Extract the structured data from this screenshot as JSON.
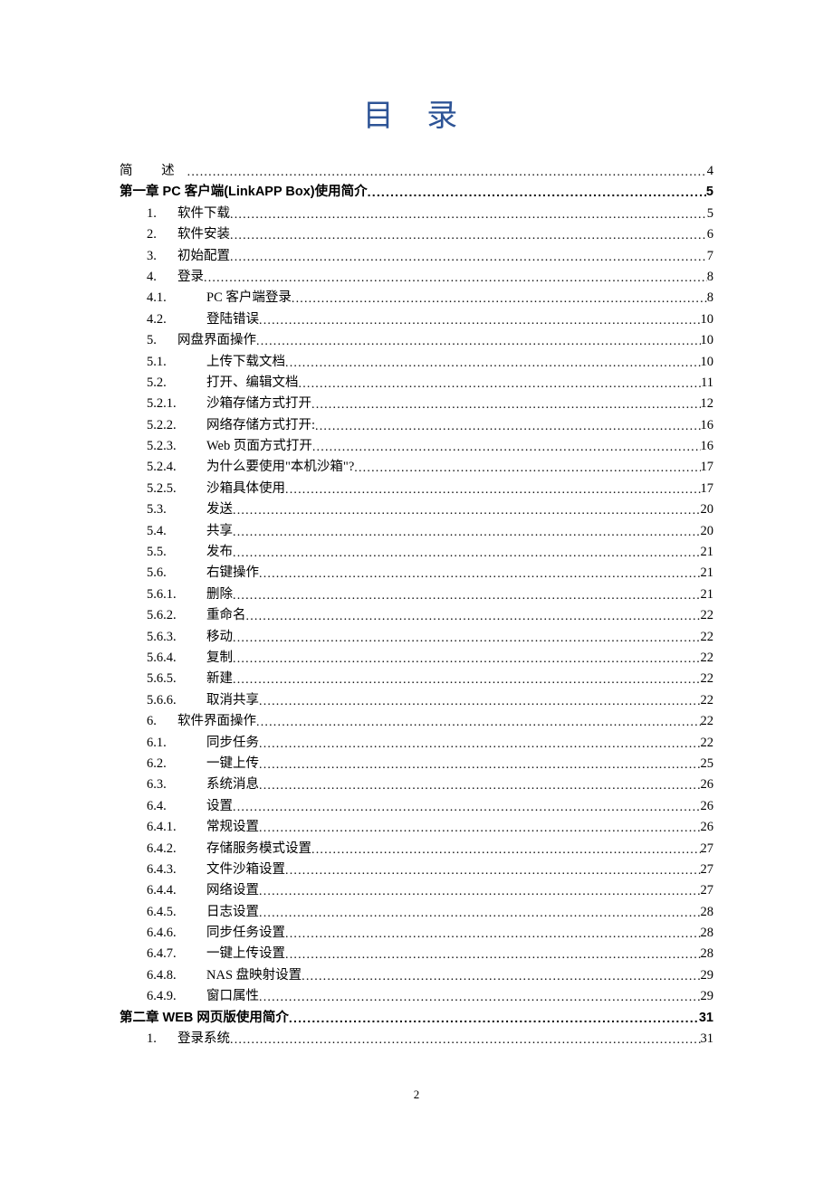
{
  "title": "目 录",
  "page_number": "2",
  "entries": [
    {
      "level": 0,
      "klass": "lvl0",
      "num": "",
      "text": "简  述",
      "page": "4",
      "spaced": true
    },
    {
      "level": 0,
      "klass": "lvl0 bold",
      "num": "",
      "text": "第一章 PC 客户端(LinkAPP Box)使用简介",
      "page": "5"
    },
    {
      "level": 1,
      "klass": "lvl1",
      "num": "1.",
      "text": "软件下载",
      "page": "5"
    },
    {
      "level": 1,
      "klass": "lvl1",
      "num": "2.",
      "text": "软件安装",
      "page": "6"
    },
    {
      "level": 1,
      "klass": "lvl1",
      "num": "3.",
      "text": "初始配置",
      "page": "7"
    },
    {
      "level": 1,
      "klass": "lvl1",
      "num": "4.",
      "text": "登录",
      "page": "8"
    },
    {
      "level": 2,
      "klass": "lvl2",
      "num": "4.1.",
      "text": "PC 客户端登录",
      "page": "8"
    },
    {
      "level": 2,
      "klass": "lvl2",
      "num": "4.2.",
      "text": "登陆错误",
      "page": "10"
    },
    {
      "level": 1,
      "klass": "lvl1",
      "num": "5.",
      "text": "网盘界面操作",
      "page": "10"
    },
    {
      "level": 2,
      "klass": "lvl2",
      "num": "5.1.",
      "text": "上传下载文档",
      "page": "10"
    },
    {
      "level": 2,
      "klass": "lvl2",
      "num": "5.2.",
      "text": "打开、编辑文档",
      "page": "11"
    },
    {
      "level": 3,
      "klass": "lvl3",
      "num": "5.2.1.",
      "text": "沙箱存储方式打开",
      "page": "12"
    },
    {
      "level": 3,
      "klass": "lvl3",
      "num": "5.2.2.",
      "text": "网络存储方式打开:",
      "page": "16"
    },
    {
      "level": 3,
      "klass": "lvl3",
      "num": "5.2.3.",
      "text": "Web 页面方式打开",
      "page": "16"
    },
    {
      "level": 3,
      "klass": "lvl3",
      "num": "5.2.4.",
      "text": "为什么要使用\"本机沙箱\"?",
      "page": "17"
    },
    {
      "level": 3,
      "klass": "lvl3",
      "num": "5.2.5.",
      "text": "沙箱具体使用",
      "page": "17"
    },
    {
      "level": 2,
      "klass": "lvl2",
      "num": "5.3.",
      "text": "发送",
      "page": "20"
    },
    {
      "level": 2,
      "klass": "lvl2",
      "num": "5.4.",
      "text": "共享",
      "page": "20"
    },
    {
      "level": 2,
      "klass": "lvl2",
      "num": "5.5.",
      "text": "发布",
      "page": "21"
    },
    {
      "level": 2,
      "klass": "lvl2",
      "num": "5.6.",
      "text": "右键操作",
      "page": "21"
    },
    {
      "level": 3,
      "klass": "lvl3",
      "num": "5.6.1.",
      "text": "删除",
      "page": "21"
    },
    {
      "level": 3,
      "klass": "lvl3",
      "num": "5.6.2.",
      "text": "重命名",
      "page": "22"
    },
    {
      "level": 3,
      "klass": "lvl3",
      "num": "5.6.3.",
      "text": "移动",
      "page": "22"
    },
    {
      "level": 3,
      "klass": "lvl3",
      "num": "5.6.4.",
      "text": "复制",
      "page": "22"
    },
    {
      "level": 3,
      "klass": "lvl3",
      "num": "5.6.5.",
      "text": "新建",
      "page": "22"
    },
    {
      "level": 3,
      "klass": "lvl3",
      "num": "5.6.6.",
      "text": "取消共享",
      "page": "22"
    },
    {
      "level": 1,
      "klass": "lvl1",
      "num": "6.",
      "text": "软件界面操作",
      "page": "22"
    },
    {
      "level": 2,
      "klass": "lvl2",
      "num": "6.1.",
      "text": "同步任务",
      "page": "22"
    },
    {
      "level": 2,
      "klass": "lvl2",
      "num": "6.2.",
      "text": "一键上传",
      "page": "25"
    },
    {
      "level": 2,
      "klass": "lvl2",
      "num": "6.3.",
      "text": "系统消息",
      "page": "26"
    },
    {
      "level": 2,
      "klass": "lvl2",
      "num": "6.4.",
      "text": "设置",
      "page": "26"
    },
    {
      "level": 3,
      "klass": "lvl3",
      "num": "6.4.1.",
      "text": "常规设置",
      "page": "26"
    },
    {
      "level": 3,
      "klass": "lvl3",
      "num": "6.4.2.",
      "text": "存储服务模式设置",
      "page": "27"
    },
    {
      "level": 3,
      "klass": "lvl3",
      "num": "6.4.3.",
      "text": "文件沙箱设置",
      "page": "27"
    },
    {
      "level": 3,
      "klass": "lvl3",
      "num": "6.4.4.",
      "text": "网络设置",
      "page": "27"
    },
    {
      "level": 3,
      "klass": "lvl3",
      "num": "6.4.5.",
      "text": "日志设置",
      "page": "28"
    },
    {
      "level": 3,
      "klass": "lvl3",
      "num": "6.4.6.",
      "text": "同步任务设置",
      "page": "28"
    },
    {
      "level": 3,
      "klass": "lvl3",
      "num": "6.4.7.",
      "text": "一键上传设置",
      "page": "28"
    },
    {
      "level": 3,
      "klass": "lvl3",
      "num": "6.4.8.",
      "text": "NAS 盘映射设置",
      "page": "29"
    },
    {
      "level": 3,
      "klass": "lvl3",
      "num": "6.4.9.",
      "text": "窗口属性",
      "page": "29"
    },
    {
      "level": 0,
      "klass": "lvl0 bold",
      "num": "",
      "text": "第二章 WEB 网页版使用简介",
      "page": "31"
    },
    {
      "level": 1,
      "klass": "lvl1",
      "num": "1.",
      "text": "登录系统",
      "page": "31"
    }
  ]
}
